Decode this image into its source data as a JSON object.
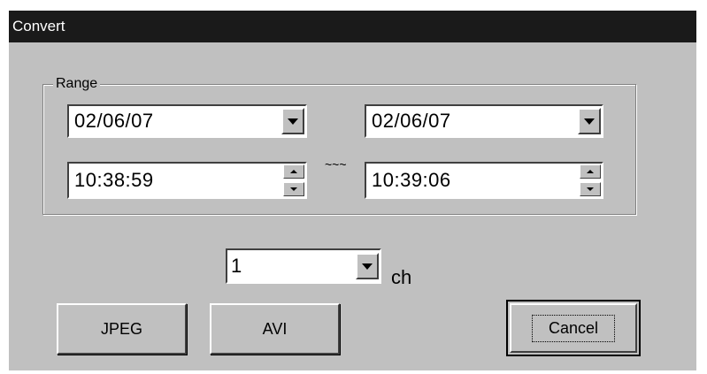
{
  "window": {
    "title": "Convert"
  },
  "range": {
    "legend": "Range",
    "start_date": "02/06/07",
    "end_date": "02/06/07",
    "start_time": "10:38:59",
    "end_time": "10:39:06",
    "separator": "~~~"
  },
  "channel": {
    "selected": "1",
    "unit_label": "ch"
  },
  "buttons": {
    "jpeg": "JPEG",
    "avi": "AVI",
    "cancel": "Cancel"
  },
  "icons": {
    "dropdown": "chevron-down-icon",
    "spin_up": "spin-up-icon",
    "spin_down": "spin-down-icon"
  },
  "colors": {
    "dialog_bg": "#c0c0c0",
    "titlebar_bg": "#1a1a1a",
    "titlebar_text": "#ffffff"
  }
}
